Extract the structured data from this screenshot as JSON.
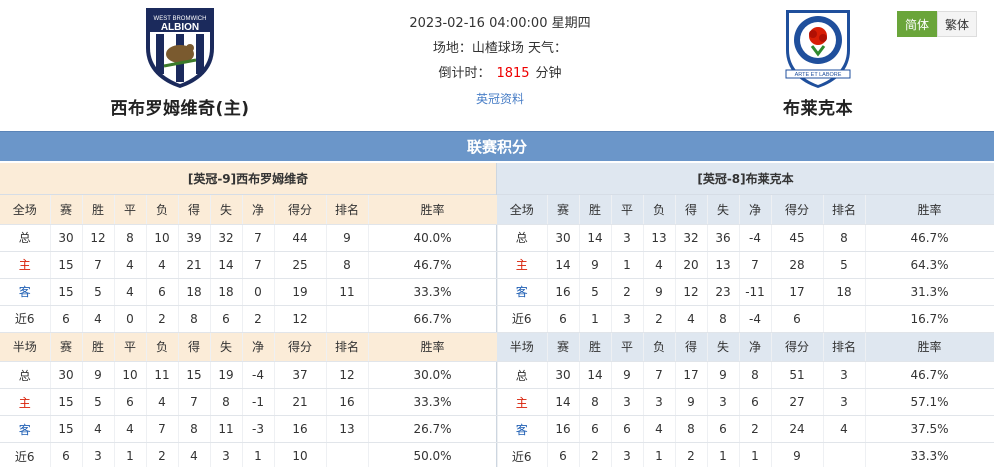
{
  "header": {
    "home_team": {
      "name": "西布罗姆维奇(主)",
      "crest_text": "WEST BROMWICH",
      "crest_big": "ALBION"
    },
    "away_team": {
      "name": "布莱克本",
      "crest_text": "BLACKBURN ROVERS F.C.",
      "crest_motto": "ARTE ET LABORE"
    },
    "datetime": "2023-02-16 04:00:00 星期四",
    "venue_label": "场地：山楂球场 天气：",
    "countdown_label": "倒计时：",
    "countdown_value": "1815",
    "countdown_unit": "分钟",
    "info_link": "英冠资料",
    "lang": {
      "simplified": "简体",
      "traditional": "繁体"
    }
  },
  "section_title": "联赛积分",
  "colors": {
    "section_bar": "#6b96c9",
    "home_header": "#fbecd8",
    "away_header": "#dfe7f0",
    "home_label": "#d81e06",
    "away_label": "#1f5fb4",
    "lang_active": "#6aa53a"
  },
  "home": {
    "title": "[英冠-9]西布罗姆维奇",
    "full": {
      "columns": [
        "全场",
        "赛",
        "胜",
        "平",
        "负",
        "得",
        "失",
        "净",
        "得分",
        "排名",
        "胜率"
      ],
      "rows": [
        [
          "总",
          "30",
          "12",
          "8",
          "10",
          "39",
          "32",
          "7",
          "44",
          "9",
          "40.0%"
        ],
        [
          "主",
          "15",
          "7",
          "4",
          "4",
          "21",
          "14",
          "7",
          "25",
          "8",
          "46.7%"
        ],
        [
          "客",
          "15",
          "5",
          "4",
          "6",
          "18",
          "18",
          "0",
          "19",
          "11",
          "33.3%"
        ],
        [
          "近6",
          "6",
          "4",
          "0",
          "2",
          "8",
          "6",
          "2",
          "12",
          "",
          "66.7%"
        ]
      ]
    },
    "half": {
      "columns": [
        "半场",
        "赛",
        "胜",
        "平",
        "负",
        "得",
        "失",
        "净",
        "得分",
        "排名",
        "胜率"
      ],
      "rows": [
        [
          "总",
          "30",
          "9",
          "10",
          "11",
          "15",
          "19",
          "-4",
          "37",
          "12",
          "30.0%"
        ],
        [
          "主",
          "15",
          "5",
          "6",
          "4",
          "7",
          "8",
          "-1",
          "21",
          "16",
          "33.3%"
        ],
        [
          "客",
          "15",
          "4",
          "4",
          "7",
          "8",
          "11",
          "-3",
          "16",
          "13",
          "26.7%"
        ],
        [
          "近6",
          "6",
          "3",
          "1",
          "2",
          "4",
          "3",
          "1",
          "10",
          "",
          "50.0%"
        ]
      ]
    }
  },
  "away": {
    "title": "[英冠-8]布莱克本",
    "full": {
      "columns": [
        "全场",
        "赛",
        "胜",
        "平",
        "负",
        "得",
        "失",
        "净",
        "得分",
        "排名",
        "胜率"
      ],
      "rows": [
        [
          "总",
          "30",
          "14",
          "3",
          "13",
          "32",
          "36",
          "-4",
          "45",
          "8",
          "46.7%"
        ],
        [
          "主",
          "14",
          "9",
          "1",
          "4",
          "20",
          "13",
          "7",
          "28",
          "5",
          "64.3%"
        ],
        [
          "客",
          "16",
          "5",
          "2",
          "9",
          "12",
          "23",
          "-11",
          "17",
          "18",
          "31.3%"
        ],
        [
          "近6",
          "6",
          "1",
          "3",
          "2",
          "4",
          "8",
          "-4",
          "6",
          "",
          "16.7%"
        ]
      ]
    },
    "half": {
      "columns": [
        "半场",
        "赛",
        "胜",
        "平",
        "负",
        "得",
        "失",
        "净",
        "得分",
        "排名",
        "胜率"
      ],
      "rows": [
        [
          "总",
          "30",
          "14",
          "9",
          "7",
          "17",
          "9",
          "8",
          "51",
          "3",
          "46.7%"
        ],
        [
          "主",
          "14",
          "8",
          "3",
          "3",
          "9",
          "3",
          "6",
          "27",
          "3",
          "57.1%"
        ],
        [
          "客",
          "16",
          "6",
          "6",
          "4",
          "8",
          "6",
          "2",
          "24",
          "4",
          "37.5%"
        ],
        [
          "近6",
          "6",
          "2",
          "3",
          "1",
          "2",
          "1",
          "1",
          "9",
          "",
          "33.3%"
        ]
      ]
    }
  }
}
